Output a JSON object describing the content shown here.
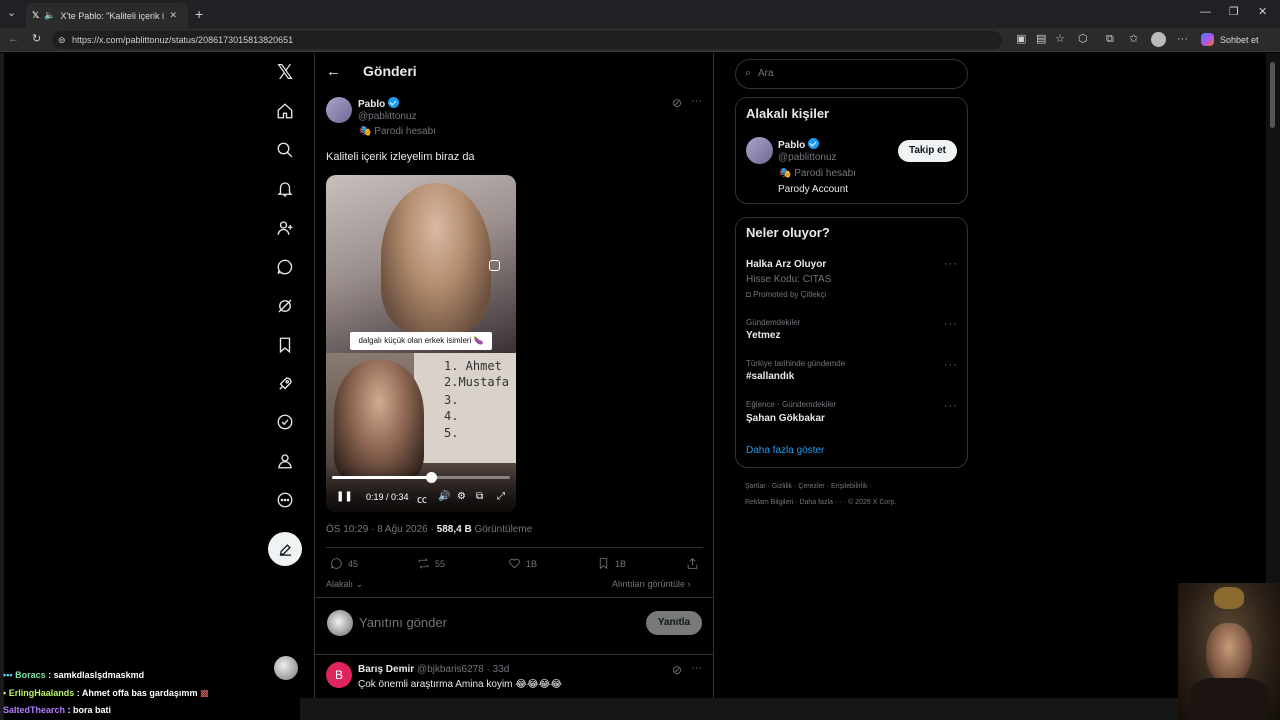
{
  "browser": {
    "tab_title": "X'te Pablo: \"Kaliteli içerik izley",
    "url": "https://x.com/pablittonuz/status/2086173015813820651",
    "copilot_label": "Sohbet et"
  },
  "header": {
    "title": "Gönderi"
  },
  "post": {
    "author_name": "Pablo",
    "author_handle": "@pablittonuz",
    "parody_label": "🎭 Parodi hesabı",
    "text": "Kaliteli içerik izleyelim biraz da",
    "video": {
      "caption": "dalgalı küçük olan erkek isimleri 🍆",
      "list": [
        "1. Ahmet",
        "2.Mustafa",
        "3.",
        "4.",
        "5."
      ],
      "time": "0:19 / 0:34",
      "progress": 0.56
    },
    "meta_time": "ÖS 10:29 · 8 Ağu 2026 ·",
    "views_count": "588,4 B",
    "views_label": "Görüntüleme",
    "actions": {
      "replies": "45",
      "reposts": "55",
      "likes": "1B",
      "bookmarks": "1B"
    },
    "related_label": "Alakalı",
    "quotes_label": "Alıntıları görüntüle",
    "reply_placeholder": "Yanıtını gönder",
    "reply_button": "Yanıtla"
  },
  "reply": {
    "avatar_letter": "B",
    "author_name": "Barış Demir",
    "author_handle": "@bjkbaris6278 · 33d",
    "text": "Çok önemli araştırma Amina koyim 😂😂😂😂"
  },
  "sidebar": {
    "search_placeholder": "Ara",
    "related_title": "Alakalı kişiler",
    "person_name": "Pablo",
    "person_handle": "@pablittonuz",
    "person_parody": "🎭 Parodi hesabı",
    "person_bio": "Parody Account",
    "follow_label": "Takip et",
    "trends_title": "Neler oluyor?",
    "trends": [
      {
        "context": "Halka Arz Oluyor",
        "title": "Hisse Kodu: CITAS",
        "promo": "Promoted by Çitlekçi"
      },
      {
        "context": "Gündemdekiler",
        "title": "Yetmez"
      },
      {
        "context": "Türkiye tarihinde gündemde",
        "title": "#sallandık"
      },
      {
        "context": "Eğlence · Gündemdekiler",
        "title": "Şahan Gökbakar"
      }
    ],
    "show_more": "Daha fazla göster",
    "footer_line1": "Şartlar  ·  Gizlilik  ·  Çerezler  ·  Erişilebilirlik  ·",
    "footer_line2": "Reklam Bilgileri  ·  Daha fazla ···  ·  © 2026 X Corp."
  },
  "stream_chat": [
    {
      "user": "Boracs",
      "message": ": samkdlaslşdmaskmd",
      "color": "#7ee3a6"
    },
    {
      "user": "ErlingHaalands",
      "message": ": Ahmet offa bas gardaşımm",
      "color": "#b9f26a"
    },
    {
      "user": "SaltedThearch",
      "message": ": bora bati",
      "color": "#b57bff"
    }
  ],
  "colors": {
    "accent": "#1d9bf0",
    "background": "#000000",
    "border": "#2f3336",
    "muted": "#71767b"
  }
}
